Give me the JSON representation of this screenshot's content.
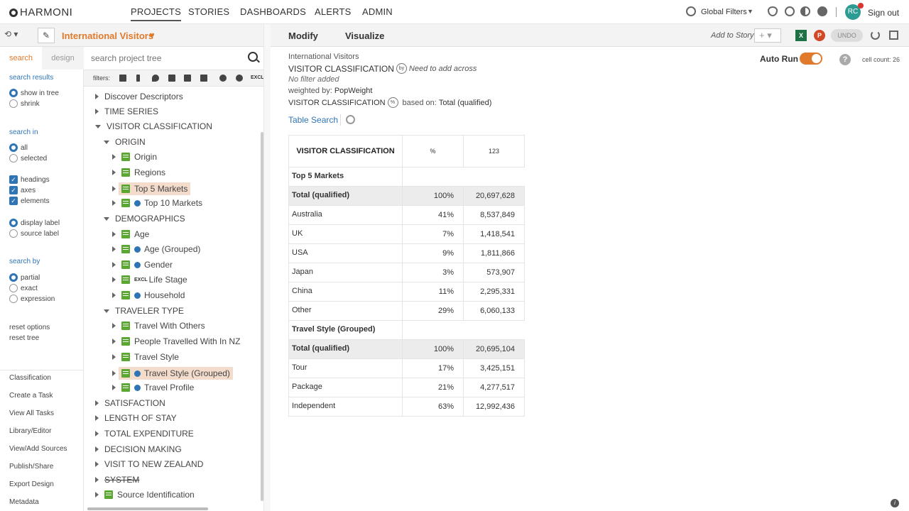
{
  "app": {
    "logo": "HARMONI"
  },
  "nav": {
    "items": [
      "PROJECTS",
      "STORIES",
      "DASHBOARDS",
      "ALERTS",
      "ADMIN"
    ],
    "active": "PROJECTS"
  },
  "topbar": {
    "global_filters": "Global Filters",
    "user_initials": "RC",
    "sign_out": "Sign out"
  },
  "project": {
    "title": "International Visitors"
  },
  "left": {
    "tabs": {
      "search": "search",
      "design": "design"
    },
    "search_results": "search results",
    "show_in_tree": "show in tree",
    "shrink": "shrink",
    "search_in": "search in",
    "all": "all",
    "selected": "selected",
    "headings": "headings",
    "axes": "axes",
    "elements": "elements",
    "display_label": "display label",
    "source_label": "source label",
    "search_by": "search by",
    "partial": "partial",
    "exact": "exact",
    "expression": "expression",
    "reset_options": "reset options",
    "reset_tree": "reset tree",
    "links": [
      "Classification",
      "Create a Task",
      "View All Tasks",
      "Library/Editor",
      "View/Add Sources",
      "Publish/Share",
      "Export Design",
      "Metadata"
    ]
  },
  "tree": {
    "search_placeholder": "search project tree",
    "filters_label": "filters:",
    "excl": "EXCL",
    "nodes": {
      "discover": "Discover Descriptors",
      "time_series": "TIME SERIES",
      "visitor_classification": "VISITOR CLASSIFICATION",
      "origin_folder": "ORIGIN",
      "origin": "Origin",
      "regions": "Regions",
      "top5": "Top 5 Markets",
      "top10": "Top 10 Markets",
      "demographics": "DEMOGRAPHICS",
      "age": "Age",
      "age_grouped": "Age (Grouped)",
      "gender": "Gender",
      "life_stage": "Life Stage",
      "household": "Household",
      "traveler_type": "TRAVELER TYPE",
      "travel_with_others": "Travel With Others",
      "people_travelled": "People Travelled With In NZ",
      "travel_style": "Travel Style",
      "travel_style_grouped": "Travel Style (Grouped)",
      "travel_profile": "Travel Profile",
      "satisfaction": "SATISFACTION",
      "length_of_stay": "LENGTH OF STAY",
      "total_expenditure": "TOTAL EXPENDITURE",
      "decision_making": "DECISION MAKING",
      "visit_nz": "VISIT TO NEW ZEALAND",
      "system": "SYSTEM",
      "source_identification": "Source Identification"
    }
  },
  "main": {
    "tabs": {
      "modify": "Modify",
      "visualize": "Visualize"
    },
    "add_to_story": "Add to Story",
    "add_symbol": "+",
    "undo": "UNDO",
    "excel": "X",
    "ppt": "P",
    "crumb": "International Visitors",
    "table_title": "VISITOR CLASSIFICATION",
    "by": "by",
    "across_hint": "Need to add across",
    "no_filter": "No filter added",
    "weighted_by_label": "weighted by:",
    "weighted_by": "PopWeight",
    "pct_title": "VISITOR CLASSIFICATION",
    "pct_badge": "%",
    "based_on_label": "based on:",
    "based_on": "Total (qualified)",
    "table_search": "Table Search",
    "auto_run": "Auto Run",
    "help": "?",
    "cell_count": "cell count: 26"
  },
  "table": {
    "headers": [
      "VISITOR CLASSIFICATION",
      "%",
      "123"
    ],
    "groups": [
      {
        "title": "Top 5 Markets",
        "total": {
          "label": "Total (qualified)",
          "pct": "100%",
          "count": "20,697,628"
        },
        "rows": [
          {
            "label": "Australia",
            "pct": "41%",
            "count": "8,537,849"
          },
          {
            "label": "UK",
            "pct": "7%",
            "count": "1,418,541"
          },
          {
            "label": "USA",
            "pct": "9%",
            "count": "1,811,866"
          },
          {
            "label": "Japan",
            "pct": "3%",
            "count": "573,907"
          },
          {
            "label": "China",
            "pct": "11%",
            "count": "2,295,331"
          },
          {
            "label": "Other",
            "pct": "29%",
            "count": "6,060,133"
          }
        ]
      },
      {
        "title": "Travel Style (Grouped)",
        "total": {
          "label": "Total (qualified)",
          "pct": "100%",
          "count": "20,695,104"
        },
        "rows": [
          {
            "label": "Tour",
            "pct": "17%",
            "count": "3,425,151"
          },
          {
            "label": "Package",
            "pct": "21%",
            "count": "4,277,517"
          },
          {
            "label": "Independent",
            "pct": "63%",
            "count": "12,992,436"
          }
        ]
      }
    ]
  },
  "colors": {
    "accent": "#e07a2c",
    "link": "#2f74b5",
    "highlight": "#f4dccd"
  }
}
